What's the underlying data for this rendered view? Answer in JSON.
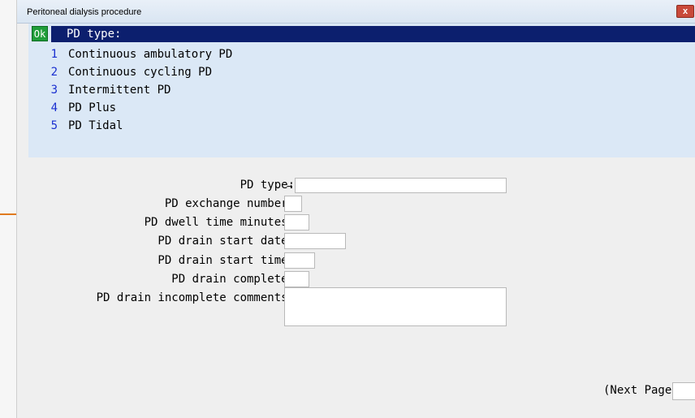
{
  "window": {
    "title": "Peritoneal dialysis procedure",
    "close_label": "x"
  },
  "list": {
    "ok_label": "Ok",
    "header": "PD type:",
    "items": [
      {
        "num": "1",
        "label": "Continuous ambulatory PD"
      },
      {
        "num": "2",
        "label": "Continuous cycling PD"
      },
      {
        "num": "3",
        "label": "Intermittent PD"
      },
      {
        "num": "4",
        "label": "PD Plus"
      },
      {
        "num": "5",
        "label": "PD Tidal"
      }
    ]
  },
  "form": {
    "pd_type_label": "PD type:",
    "pd_type_value": "",
    "arrow": "→",
    "exchange_label": "PD exchange number:",
    "dwell_label": "PD dwell time minutes:",
    "drain_date_label": "PD drain start date:",
    "drain_time_label": "PD drain start time:",
    "drain_complete_label": "PD drain complete:",
    "incomplete_comments_label": "PD drain incomplete comments:"
  },
  "footer": {
    "next_page_label": "(Next Page)"
  },
  "colors": {
    "header_bg": "#0c1f6e",
    "ok_bg": "#1f9d3a",
    "list_bg": "#dbe8f6",
    "option_number": "#1a2fd0",
    "marker": "#e07a1f"
  }
}
